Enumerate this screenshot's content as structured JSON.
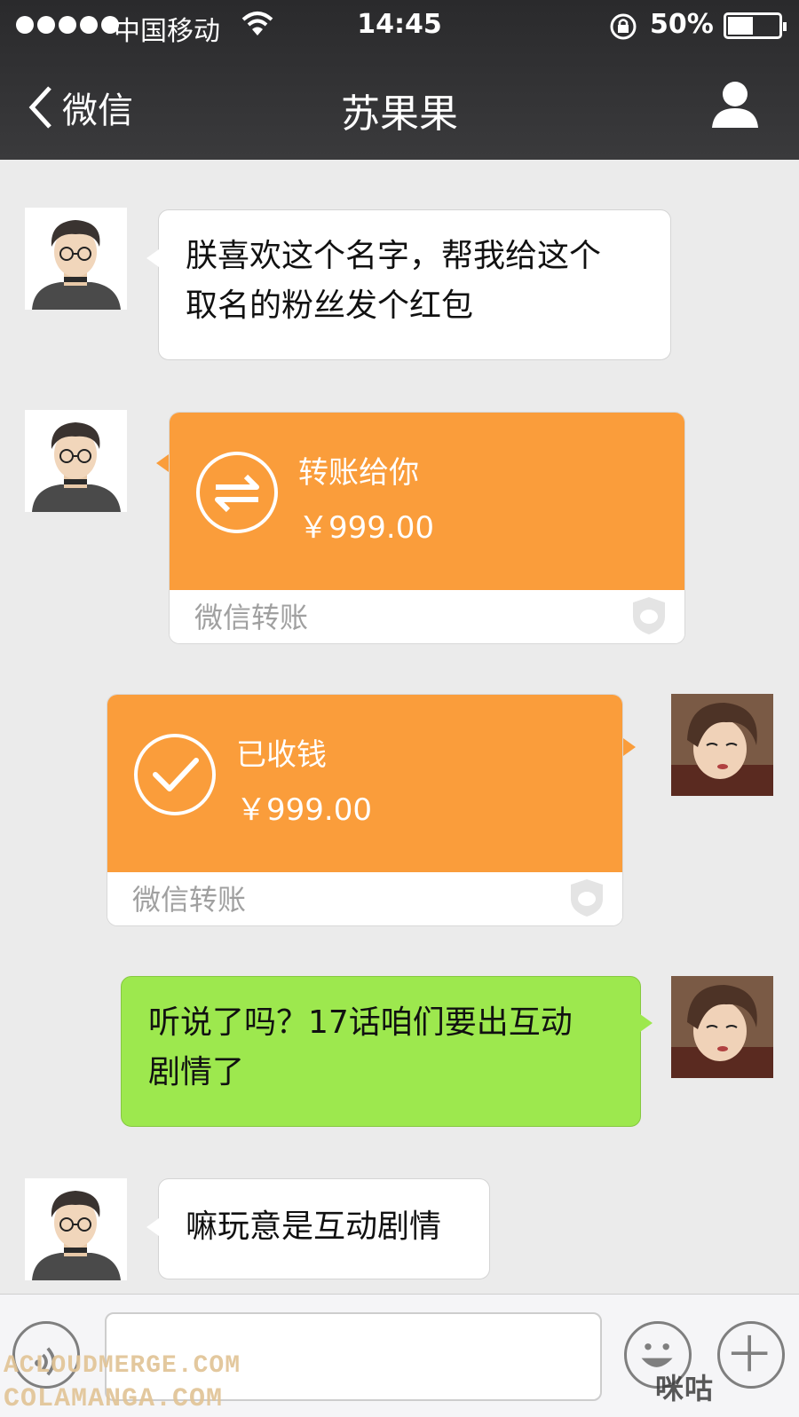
{
  "status_bar": {
    "carrier": "中国移动",
    "time": "14:45",
    "battery_percent": "50%",
    "icons": [
      "signal-dots-icon",
      "wifi-icon",
      "rotation-lock-icon",
      "battery-icon"
    ]
  },
  "nav": {
    "back_label": "微信",
    "title": "苏果果",
    "profile_icon": "person-icon"
  },
  "messages": [
    {
      "side": "left",
      "type": "text",
      "lines": [
        "朕喜欢这个名字，帮我给这个",
        "取名的粉丝发个红包"
      ]
    },
    {
      "side": "left",
      "type": "transfer",
      "title": "转账给你",
      "amount": "￥999.00",
      "footer": "微信转账",
      "icon": "transfer-arrows-icon"
    },
    {
      "side": "right",
      "type": "transfer",
      "title": "已收钱",
      "amount": "￥999.00",
      "footer": "微信转账",
      "icon": "check-circle-icon"
    },
    {
      "side": "right",
      "type": "text",
      "lines": [
        "听说了吗？17话咱们要出互动",
        "剧情了"
      ]
    },
    {
      "side": "left",
      "type": "text",
      "lines": [
        "嘛玩意是互动剧情"
      ]
    }
  ],
  "input_bar": {
    "text_value": "",
    "icons": [
      "voice-icon",
      "emoji-icon",
      "plus-icon"
    ]
  },
  "watermarks": [
    "ACLOUDMERGE.COM",
    "COLAMANGA.COM",
    "咪咕"
  ],
  "colors": {
    "nav_bg": "#2f2f31",
    "chat_bg": "#ebebeb",
    "transfer_orange": "#fa9d3b",
    "sent_green": "#9de84e"
  }
}
